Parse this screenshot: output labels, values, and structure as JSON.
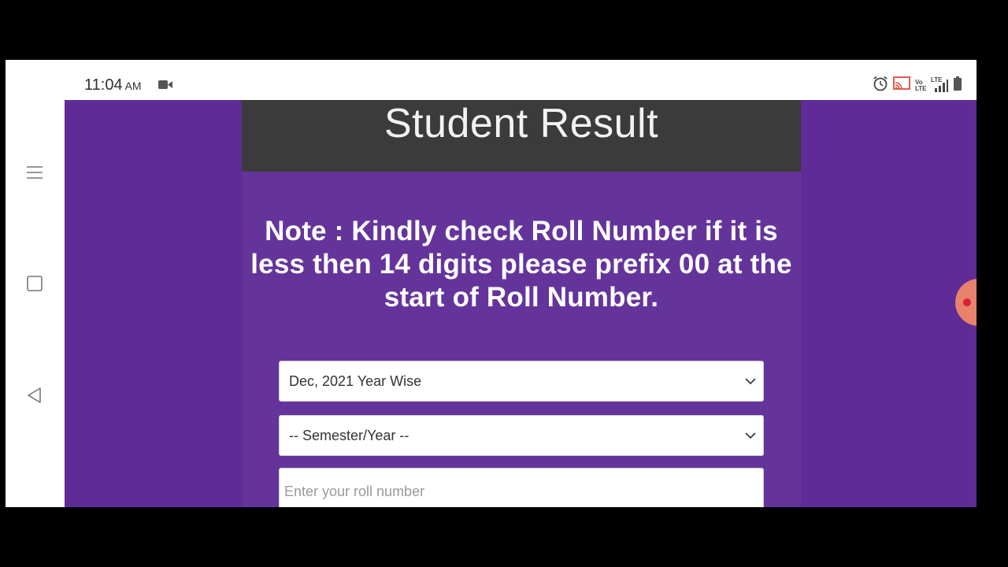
{
  "status_bar": {
    "time": "11:04",
    "ampm": "AM",
    "icons": [
      "video-record-icon",
      "alarm-icon",
      "cast-icon",
      "volte-icon",
      "lte-signal-icon",
      "battery-icon"
    ],
    "volte_label": "Vo LTE",
    "lte_label": "LTE"
  },
  "android_nav": {
    "items": [
      "menu-icon",
      "recents-icon",
      "back-icon"
    ]
  },
  "page": {
    "title": "Student Result",
    "note": "Note : Kindly check Roll Number if it is less then 14 digits please prefix 00 at the start of Roll Number.",
    "exam_select": {
      "selected": "Dec, 2021 Year Wise"
    },
    "semester_select": {
      "selected": "-- Semester/Year --"
    },
    "roll_input": {
      "value": "",
      "placeholder": "Enter your roll number"
    }
  },
  "colors": {
    "background": "#5e2b97",
    "card": "#64349b",
    "title_bar": "#3b3b3b",
    "float_button": "#e8826c"
  }
}
